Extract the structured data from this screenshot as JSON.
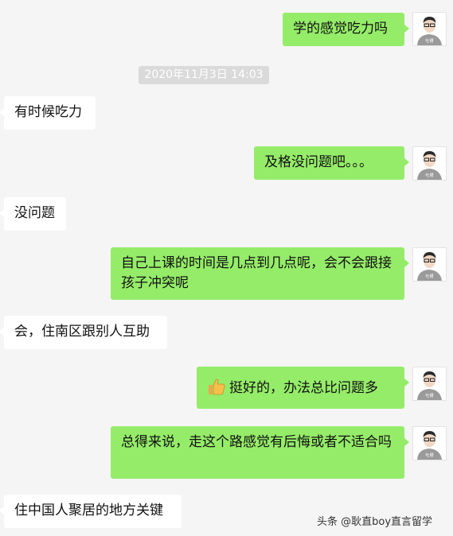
{
  "messages": [
    {
      "side": "out",
      "text": "学的感觉吃力吗"
    },
    {
      "timestamp": "2020年11月3日 14:03"
    },
    {
      "side": "in",
      "text": "有时候吃力"
    },
    {
      "side": "out",
      "text": "及格没问题吧。。。"
    },
    {
      "side": "in",
      "text": "没问题"
    },
    {
      "side": "out",
      "text": "自己上课的时间是几点到几点呢，会不会跟接孩子冲突呢"
    },
    {
      "side": "in",
      "text": "会，住南区跟别人互助"
    },
    {
      "side": "out",
      "text": "挺好的，办法总比问题多",
      "emoji": "thumbs-up"
    },
    {
      "side": "out",
      "text": "总得来说，走这个路感觉有后悔或者不适合吗"
    },
    {
      "side": "in",
      "text": "住中国人聚居的地方关键"
    }
  ],
  "avatar": {
    "label": "吐槽",
    "shirt_color": "#9a9a9a"
  },
  "colors": {
    "outgoing": "#95ec69",
    "incoming": "#ffffff",
    "background": "#f5f5f5"
  },
  "watermark": "头条 @耿直boy直言留学"
}
